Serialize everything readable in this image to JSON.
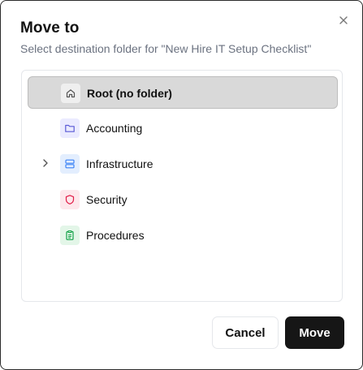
{
  "dialog": {
    "title": "Move to",
    "subtitle": "Select destination folder for \"New Hire IT Setup Checklist\""
  },
  "folders": [
    {
      "label": "Root (no folder)",
      "icon": "home-icon",
      "selected": true,
      "expandable": false,
      "color": "#555555",
      "bg": "#efefef"
    },
    {
      "label": "Accounting",
      "icon": "folder-icon",
      "selected": false,
      "expandable": false,
      "color": "#5b5bd6",
      "bg": "#ebebff"
    },
    {
      "label": "Infrastructure",
      "icon": "server-icon",
      "selected": false,
      "expandable": true,
      "color": "#3b82f6",
      "bg": "#e3eefe"
    },
    {
      "label": "Security",
      "icon": "shield-icon",
      "selected": false,
      "expandable": false,
      "color": "#e11d48",
      "bg": "#fde8ec"
    },
    {
      "label": "Procedures",
      "icon": "clipboard-icon",
      "selected": false,
      "expandable": false,
      "color": "#16a34a",
      "bg": "#e3f6e8"
    }
  ],
  "actions": {
    "cancel_label": "Cancel",
    "move_label": "Move"
  }
}
